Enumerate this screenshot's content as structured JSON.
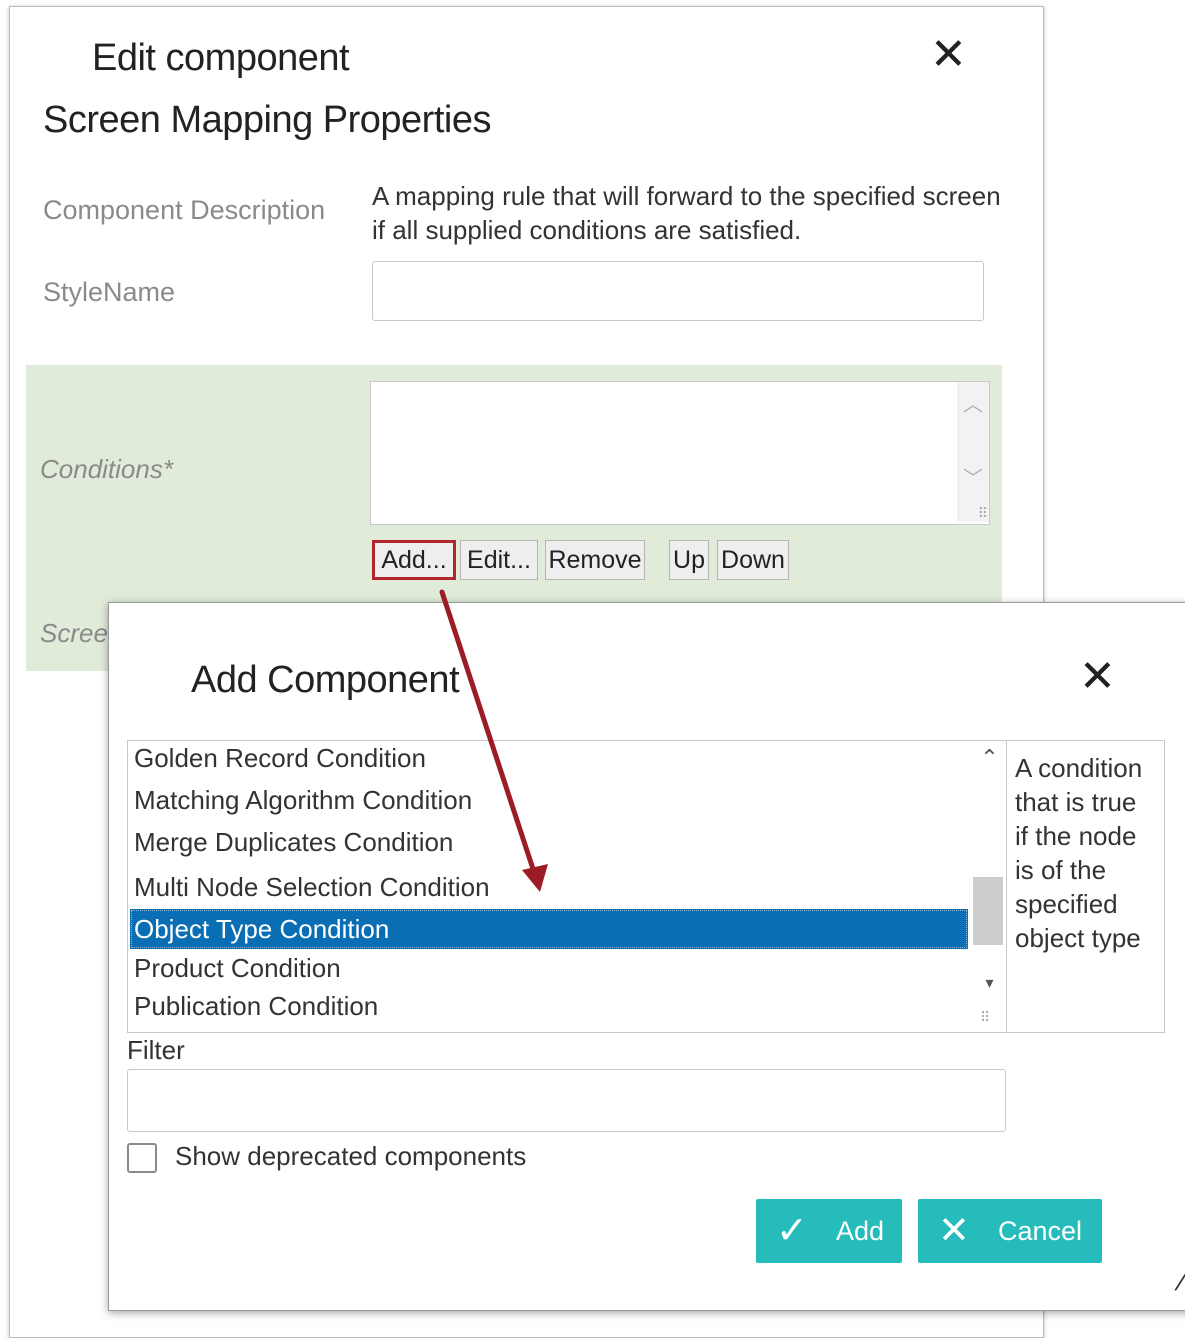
{
  "edit_dialog": {
    "title": "Edit component",
    "close_glyph": "✕",
    "subtitle": "Screen Mapping Properties",
    "description_label": "Component Description",
    "description_text": "A mapping rule that will forward to the specified screen if all supplied conditions are satisfied.",
    "stylename_label": "StyleName",
    "stylename_value": "",
    "conditions_label": "Conditions*",
    "screen_label_partial": "Scree",
    "buttons": {
      "add": "Add...",
      "edit": "Edit...",
      "remove": "Remove",
      "up": "Up",
      "down": "Down"
    }
  },
  "add_dialog": {
    "title": "Add Component",
    "close_glyph": "✕",
    "components": [
      "Golden Record Condition",
      "Matching Algorithm Condition",
      "Merge Duplicates Condition",
      "Multi Node Selection Condition",
      "Object Type Condition",
      "Product Condition",
      "Publication Condition"
    ],
    "selected_component": "Object Type Condition",
    "help_text": "A condition that is true if the node is of the specified object type",
    "filter_label": "Filter",
    "filter_value": "",
    "show_deprecated_label": "Show deprecated components",
    "show_deprecated_checked": false,
    "add_button": "Add",
    "cancel_button": "Cancel",
    "accent_color": "#26bcbc",
    "selection_color": "#0a6eb5"
  },
  "annotation": {
    "highlight_color": "#b3242d",
    "icon": "arrow-annotation"
  }
}
